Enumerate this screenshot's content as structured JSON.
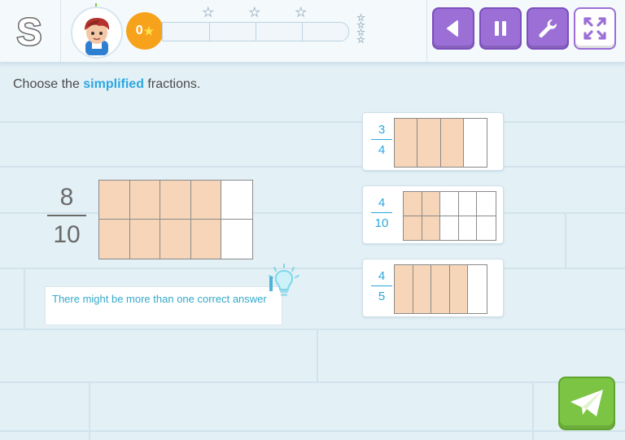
{
  "header": {
    "logo_letter": "S",
    "score": "0",
    "progress_fraction": 0,
    "progress_star_count": 3,
    "buttons": [
      "back-icon",
      "pause-icon",
      "wrench-icon",
      "fullscreen-icon"
    ]
  },
  "question": {
    "prefix": "Choose the ",
    "highlight": "simplified",
    "suffix": " fractions."
  },
  "main_fraction": {
    "numerator": "8",
    "denominator": "10",
    "grid": {
      "rows": 2,
      "cols": 5,
      "shaded_per_row": 4
    }
  },
  "hint": {
    "text": "There might be more than one correct answer",
    "icon": "lightbulb-icon"
  },
  "options": [
    {
      "numerator": "3",
      "denominator": "4",
      "rows": 1,
      "cols": 4,
      "shaded_per_row": 3
    },
    {
      "numerator": "4",
      "denominator": "10",
      "rows": 2,
      "cols": 5,
      "shaded_per_row": 2
    },
    {
      "numerator": "4",
      "denominator": "5",
      "rows": 1,
      "cols": 5,
      "shaded_per_row": 4
    }
  ],
  "submit": {
    "icon": "paper-plane-icon"
  },
  "colors": {
    "accent_purple": "#9b6fd6",
    "highlight_blue": "#2ea7df",
    "shade": "#f6d5b8",
    "submit_green": "#7cc443",
    "score_orange": "#f7a21b"
  }
}
